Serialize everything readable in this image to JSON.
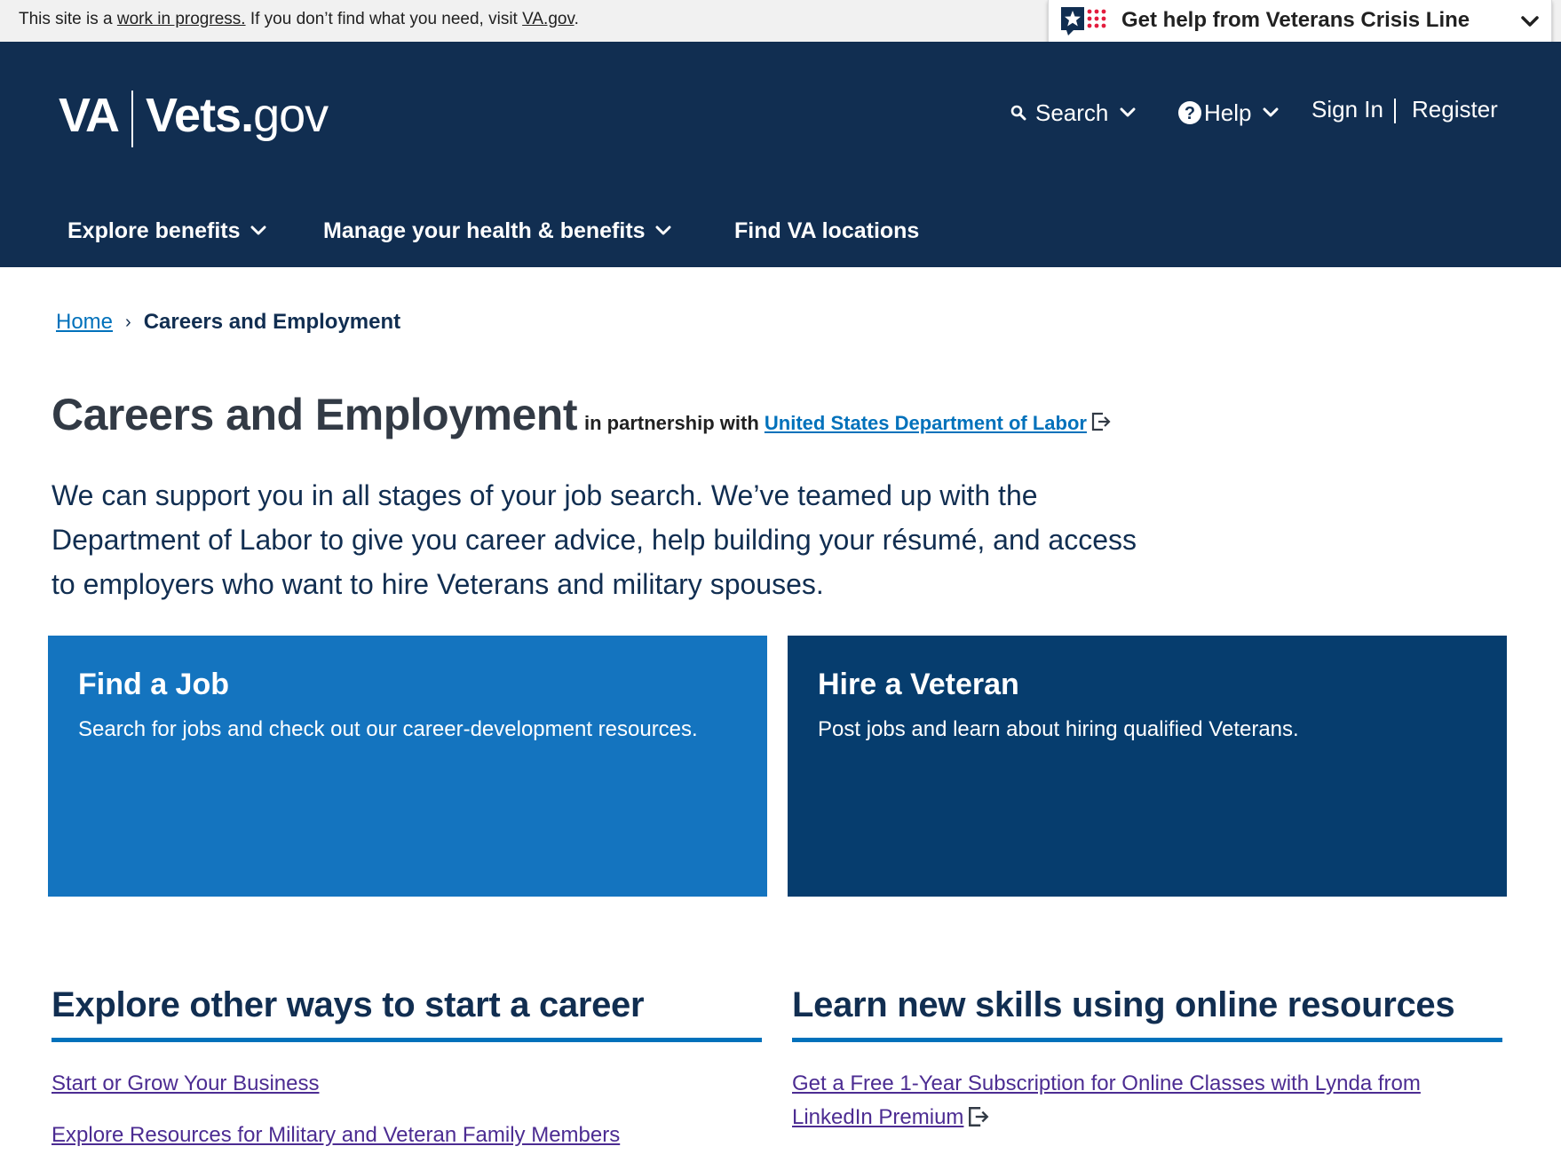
{
  "topbar": {
    "prefix": "This site is a ",
    "wip_link": "work in progress.",
    "middle": " If you don’t find what you need, visit ",
    "va_link": "VA.gov",
    "suffix": "."
  },
  "crisis_line": {
    "label": "Get help from Veterans Crisis Line"
  },
  "header": {
    "logo_va": "VA",
    "logo_vets": "Vets.",
    "logo_gov": "gov",
    "search": "Search",
    "help": "Help",
    "sign_in": "Sign In",
    "register": "Register"
  },
  "nav": {
    "items": [
      {
        "label": "Explore benefits"
      },
      {
        "label": "Manage your health & benefits"
      },
      {
        "label": "Find VA locations"
      }
    ]
  },
  "breadcrumb": {
    "home": "Home",
    "separator": "›",
    "current": "Careers and Employment"
  },
  "main": {
    "title": "Careers and Employment",
    "partner_prefix": "in partnership with",
    "partner_link": "United States Department of Labor",
    "intro": "We can support you in all stages of your job search. We’ve teamed up with the Department of Labor to give you career advice, help building your résumé, and access to employers who want to hire Veterans and military spouses."
  },
  "cards": [
    {
      "title": "Find a Job",
      "description": "Search for jobs and check out our career-development resources."
    },
    {
      "title": "Hire a Veteran",
      "description": "Post jobs and learn about hiring qualified Veterans."
    }
  ],
  "sections": [
    {
      "title": "Explore other ways to start a career",
      "links": [
        "Start or Grow Your Business",
        "Explore Resources for Military and Veteran Family Members"
      ]
    },
    {
      "title": "Learn new skills using online resources",
      "links": [
        "Get a Free 1-Year Subscription for Online Classes with Lynda from LinkedIn Premium"
      ]
    }
  ],
  "colors": {
    "header_bg": "#112e51",
    "card_find_job": "#1474bf",
    "card_hire_veteran": "#063d6e",
    "link_blue": "#0071bb",
    "visited_link": "#4c2c92"
  }
}
